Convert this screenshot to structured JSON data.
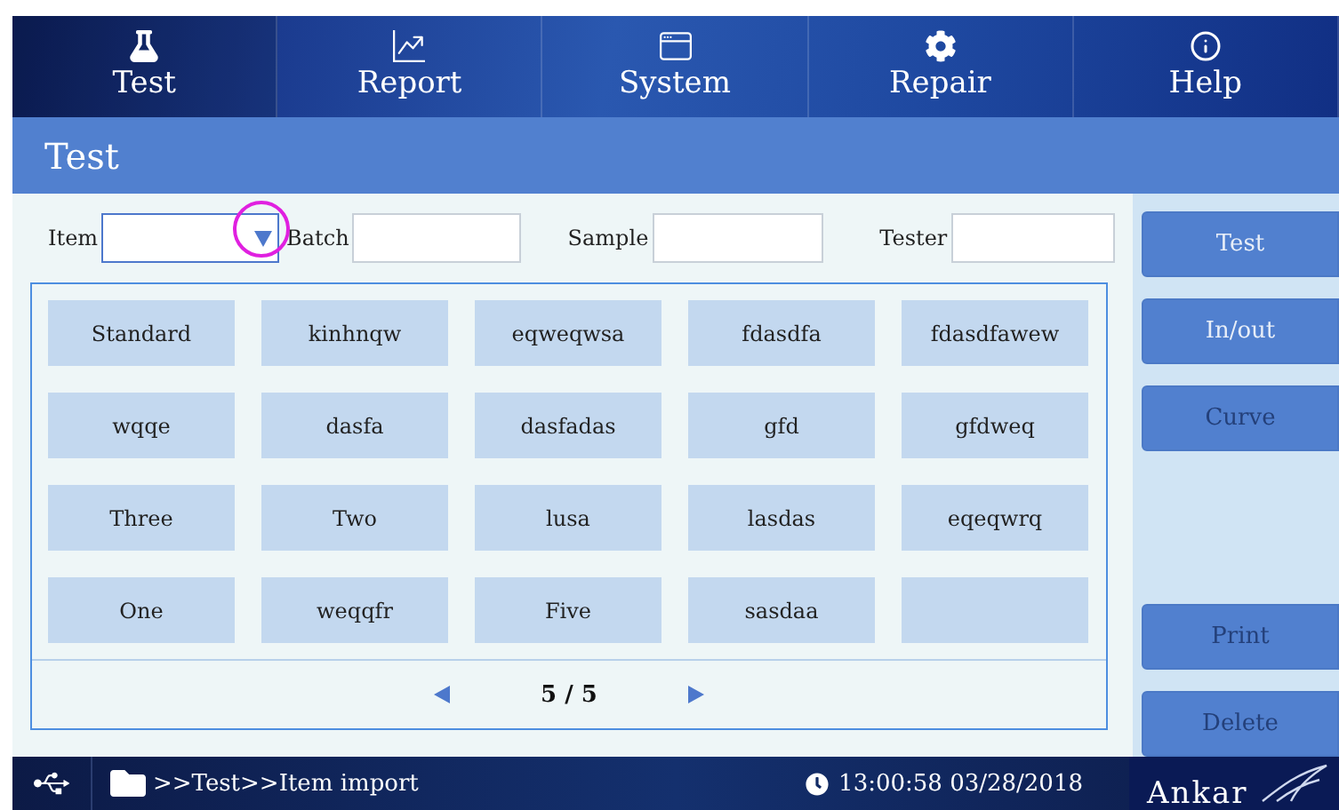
{
  "nav": [
    {
      "label": "Test",
      "selected": true
    },
    {
      "label": "Report",
      "selected": false
    },
    {
      "label": "System",
      "selected": false
    },
    {
      "label": "Repair",
      "selected": false
    },
    {
      "label": "Help",
      "selected": false
    }
  ],
  "page_title": "Test",
  "filters": [
    {
      "label": "Item",
      "kind": "dropdown",
      "highlighted": true
    },
    {
      "label": "Batch",
      "kind": "text"
    },
    {
      "label": "Sample",
      "kind": "text"
    },
    {
      "label": "Tester",
      "kind": "text"
    }
  ],
  "items": [
    {
      "label": "Standard",
      "kind": "item"
    },
    {
      "label": "kinhnqw",
      "kind": "item"
    },
    {
      "label": "eqweqwsa",
      "kind": "item"
    },
    {
      "label": "fdasdfa",
      "kind": "item"
    },
    {
      "label": "fdasdfawew",
      "kind": "item"
    },
    {
      "label": "wqqe",
      "kind": "item"
    },
    {
      "label": "dasfa",
      "kind": "item"
    },
    {
      "label": "dasfadas",
      "kind": "item"
    },
    {
      "label": "gfd",
      "kind": "item"
    },
    {
      "label": "gfdweq",
      "kind": "item"
    },
    {
      "label": "Three",
      "kind": "item"
    },
    {
      "label": "Two",
      "kind": "item"
    },
    {
      "label": "lusa",
      "kind": "item"
    },
    {
      "label": "lasdas",
      "kind": "item"
    },
    {
      "label": "eqeqwrq",
      "kind": "item"
    },
    {
      "label": "One",
      "kind": "item"
    },
    {
      "label": "weqqfr",
      "kind": "item"
    },
    {
      "label": "Five",
      "kind": "item"
    },
    {
      "label": "sasdaa",
      "kind": "item"
    },
    {
      "kind": "empty"
    }
  ],
  "pager": {
    "page": "5 / 5"
  },
  "actions": [
    {
      "label": "Test",
      "disabled": false
    },
    {
      "label": "In/out",
      "disabled": false
    },
    {
      "label": "Curve",
      "disabled": true
    },
    {
      "kind": "gap"
    },
    {
      "label": "Print",
      "disabled": true
    },
    {
      "label": "Delete",
      "disabled": true
    }
  ],
  "status_bar": {
    "path": ">>Test>>Item import",
    "time": "13:00:58 03/28/2018",
    "logo": "Ankar"
  }
}
